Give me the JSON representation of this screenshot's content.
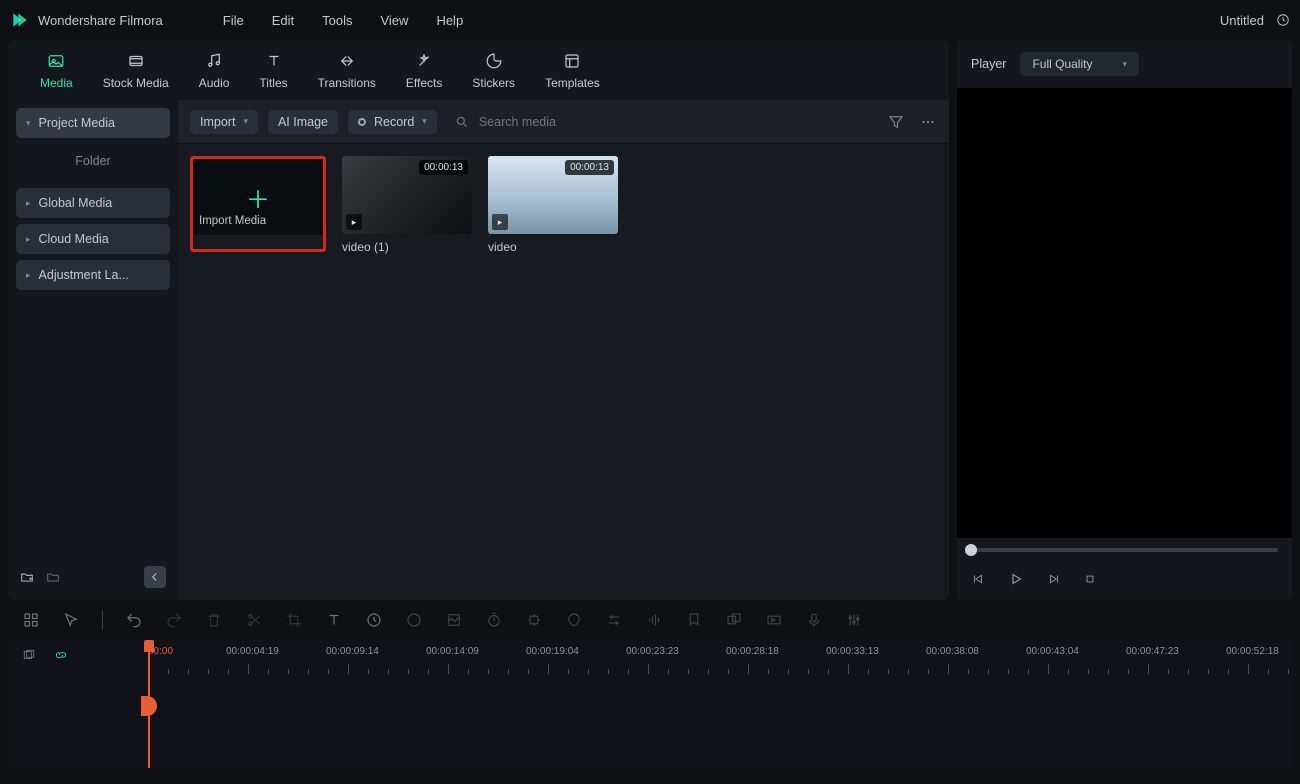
{
  "app_name": "Wondershare Filmora",
  "menubar": {
    "items": [
      "File",
      "Edit",
      "Tools",
      "View",
      "Help"
    ]
  },
  "doc_title": "Untitled",
  "tabs": [
    {
      "id": "media",
      "label": "Media",
      "active": true
    },
    {
      "id": "stock",
      "label": "Stock Media"
    },
    {
      "id": "audio",
      "label": "Audio"
    },
    {
      "id": "titles",
      "label": "Titles"
    },
    {
      "id": "transitions",
      "label": "Transitions"
    },
    {
      "id": "effects",
      "label": "Effects"
    },
    {
      "id": "stickers",
      "label": "Stickers"
    },
    {
      "id": "templates",
      "label": "Templates"
    }
  ],
  "sidebar": {
    "project_media": "Project Media",
    "folder": "Folder",
    "items": [
      {
        "label": "Global Media"
      },
      {
        "label": "Cloud Media"
      },
      {
        "label": "Adjustment La..."
      }
    ]
  },
  "toolbar": {
    "import": "Import",
    "ai_image": "AI Image",
    "record": "Record",
    "search_placeholder": "Search media"
  },
  "media": {
    "import_label": "Import Media",
    "clips": [
      {
        "name": "video (1)",
        "duration": "00:00:13",
        "style": "person"
      },
      {
        "name": "video",
        "duration": "00:00:13",
        "style": "lab"
      }
    ]
  },
  "player": {
    "title": "Player",
    "quality": "Full Quality"
  },
  "timeline": {
    "start": "00:00",
    "timecodes": [
      "00:00:04:19",
      "00:00:09:14",
      "00:00:14:09",
      "00:00:19:04",
      "00:00:23:23",
      "00:00:28:18",
      "00:00:33:13",
      "00:00:38:08",
      "00:00:43:04",
      "00:00:47:23",
      "00:00:52:18"
    ]
  }
}
